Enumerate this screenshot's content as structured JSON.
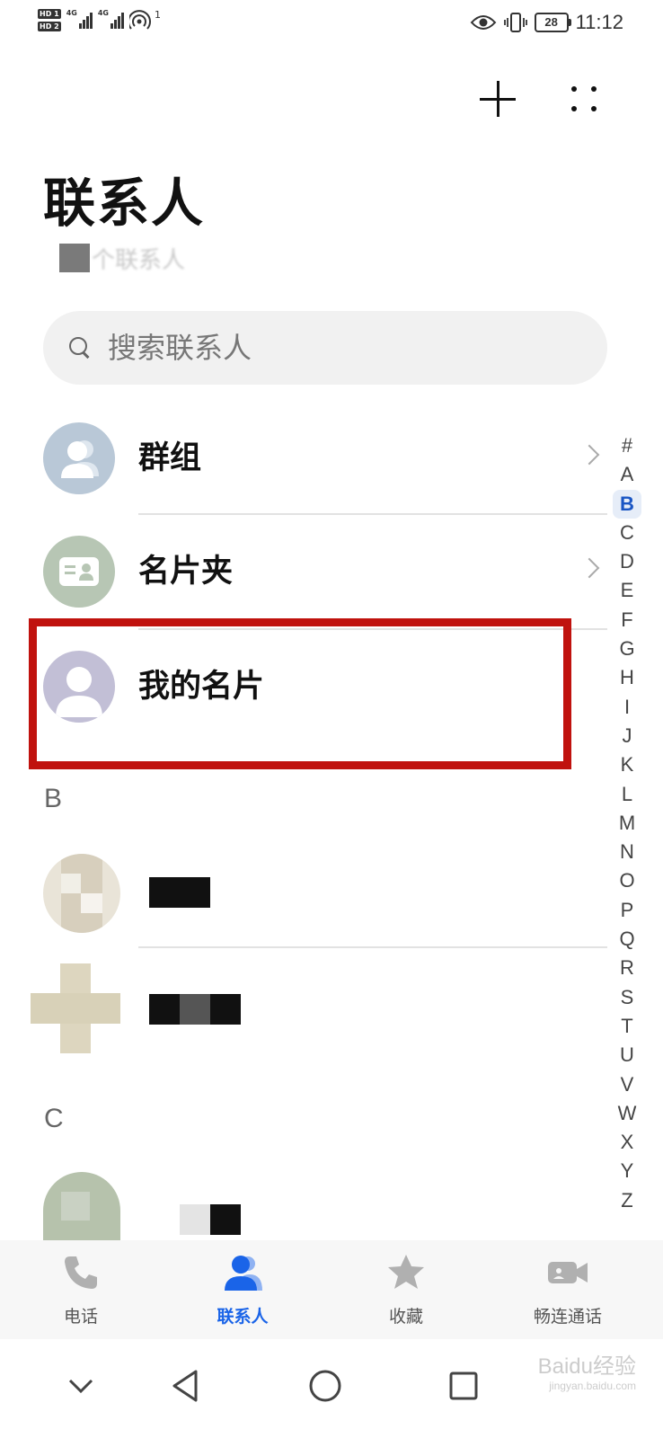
{
  "status_bar": {
    "sim1": "HD 1",
    "sim2": "HD 2",
    "net1": "4G",
    "net2": "4G",
    "hotspot_count": "1",
    "battery": "28",
    "time": "11:12"
  },
  "header": {
    "title": "联系人",
    "subtitle_suffix": "个联系人"
  },
  "search": {
    "placeholder": "搜索联系人"
  },
  "rows": {
    "groups_label": "群组",
    "cards_label": "名片夹",
    "my_card_label": "我的名片"
  },
  "sections": {
    "b": "B",
    "c": "C"
  },
  "index_bar": [
    "#",
    "A",
    "B",
    "C",
    "D",
    "E",
    "F",
    "G",
    "H",
    "I",
    "J",
    "K",
    "L",
    "M",
    "N",
    "O",
    "P",
    "Q",
    "R",
    "S",
    "T",
    "U",
    "V",
    "W",
    "X",
    "Y",
    "Z"
  ],
  "index_active": "B",
  "bottom_nav": {
    "phone": "电话",
    "contacts": "联系人",
    "favorites": "收藏",
    "meetime": "畅连通话"
  },
  "colors": {
    "accent": "#1a64e8",
    "highlight_border": "#c0120e"
  },
  "watermark": {
    "brand": "Baidu经验",
    "url": "jingyan.baidu.com"
  }
}
